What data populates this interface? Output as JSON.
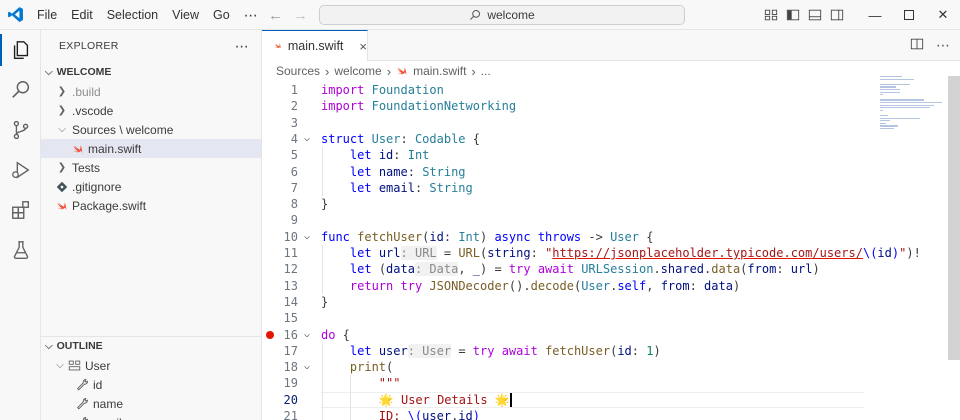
{
  "window": {
    "menu": [
      "File",
      "Edit",
      "Selection",
      "View",
      "Go"
    ],
    "more": "⋯",
    "search_text": "welcome"
  },
  "sidebar": {
    "header": "EXPLORER",
    "header_more": "⋯",
    "workspace": "WELCOME",
    "items": [
      {
        "label": ".build",
        "type": "folder",
        "dim": true
      },
      {
        "label": ".vscode",
        "type": "folder",
        "dim": false
      },
      {
        "label": "Sources \\ welcome",
        "type": "folder-open",
        "dim": false
      },
      {
        "label": "main.swift",
        "type": "swift",
        "selected": true
      },
      {
        "label": "Tests",
        "type": "folder",
        "dim": false
      },
      {
        "label": ".gitignore",
        "type": "git",
        "dim": false
      },
      {
        "label": "Package.swift",
        "type": "swift",
        "dim": false
      }
    ],
    "outline": {
      "title": "OUTLINE",
      "items": [
        {
          "label": "User",
          "type": "struct",
          "indent": 1
        },
        {
          "label": "id",
          "type": "prop",
          "indent": 2
        },
        {
          "label": "name",
          "type": "prop",
          "indent": 2
        },
        {
          "label": "email",
          "type": "prop",
          "indent": 2
        }
      ]
    }
  },
  "editor": {
    "tab_label": "main.swift",
    "tab_close": "×",
    "breadcrumb": [
      "Sources",
      "welcome",
      "main.swift",
      "..."
    ],
    "current_line": 20,
    "breakpoint_line": 16,
    "lines": [
      {
        "n": "1",
        "html": "<span class='kw2'>import</span> <span class='ty'>Foundation</span>"
      },
      {
        "n": "2",
        "html": "<span class='kw2'>import</span> <span class='ty'>FoundationNetworking</span>"
      },
      {
        "n": "3",
        "html": ""
      },
      {
        "n": "4",
        "fold": true,
        "html": "<span class='kw'>struct</span> <span class='ty'>User</span>: <span class='ty'>Codable</span> {"
      },
      {
        "n": "5",
        "html": "    <span class='kw'>let</span> <span class='va'>id</span>: <span class='ty'>Int</span>"
      },
      {
        "n": "6",
        "html": "    <span class='kw'>let</span> <span class='va'>name</span>: <span class='ty'>String</span>"
      },
      {
        "n": "7",
        "html": "    <span class='kw'>let</span> <span class='va'>email</span>: <span class='ty'>String</span>"
      },
      {
        "n": "8",
        "html": "}"
      },
      {
        "n": "9",
        "html": ""
      },
      {
        "n": "10",
        "fold": true,
        "html": "<span class='kw'>func</span> <span class='fn'>fetchUser</span>(<span class='va'>id</span>: <span class='ty'>Int</span>) <span class='kw'>async</span> <span class='kw'>throws</span> -> <span class='ty'>User</span> {"
      },
      {
        "n": "11",
        "html": "    <span class='kw'>let</span> <span class='va'>url</span><span class='hint'>: URL</span> = <span class='fn'>URL</span>(<span class='va'>string</span>: <span class='st'>\"</span><span class='url'>https://jsonplaceholder.typicode.com/users/</span><span class='kw'>\\(</span><span class='va'>id</span><span class='kw'>)</span><span class='st'>\"</span>)!"
      },
      {
        "n": "12",
        "html": "    <span class='kw'>let</span> (<span class='va'>data</span><span class='hint'>: Data</span>, <span class='va'>_</span>) = <span class='kw2'>try</span> <span class='kw2'>await</span> <span class='ty'>URLSession</span>.<span class='va'>shared</span>.<span class='fn'>data</span>(<span class='va'>from</span>: <span class='va'>url</span>)"
      },
      {
        "n": "13",
        "html": "    <span class='kw2'>return</span> <span class='kw2'>try</span> <span class='fn'>JSONDecoder</span>().<span class='fn'>decode</span>(<span class='ty'>User</span>.<span class='kw'>self</span>, <span class='va'>from</span>: <span class='va'>data</span>)"
      },
      {
        "n": "14",
        "html": "}"
      },
      {
        "n": "15",
        "html": ""
      },
      {
        "n": "16",
        "fold": true,
        "html": "<span class='kw2'>do</span> {"
      },
      {
        "n": "17",
        "html": "    <span class='kw'>let</span> <span class='va'>user</span><span class='hint'>: User</span> = <span class='kw2'>try</span> <span class='kw2'>await</span> <span class='fn'>fetchUser</span>(<span class='va'>id</span>: <span class='nu'>1</span>)"
      },
      {
        "n": "18",
        "fold": true,
        "html": "    <span class='fn'>print</span>("
      },
      {
        "n": "19",
        "html": "        <span class='st'>\"\"\"</span>"
      },
      {
        "n": "20",
        "html": "        <span class='st'>🌟 User Details 🌟</span><span class='caret'></span>"
      },
      {
        "n": "21",
        "html": "        <span class='st'>ID: </span><span class='kw'>\\(</span><span class='va'>user</span>.<span class='va'>id</span><span class='kw'>)</span>"
      }
    ]
  },
  "colors": {
    "accent": "#005fb8",
    "breakpoint": "#e51400",
    "swift": "#f05138"
  }
}
